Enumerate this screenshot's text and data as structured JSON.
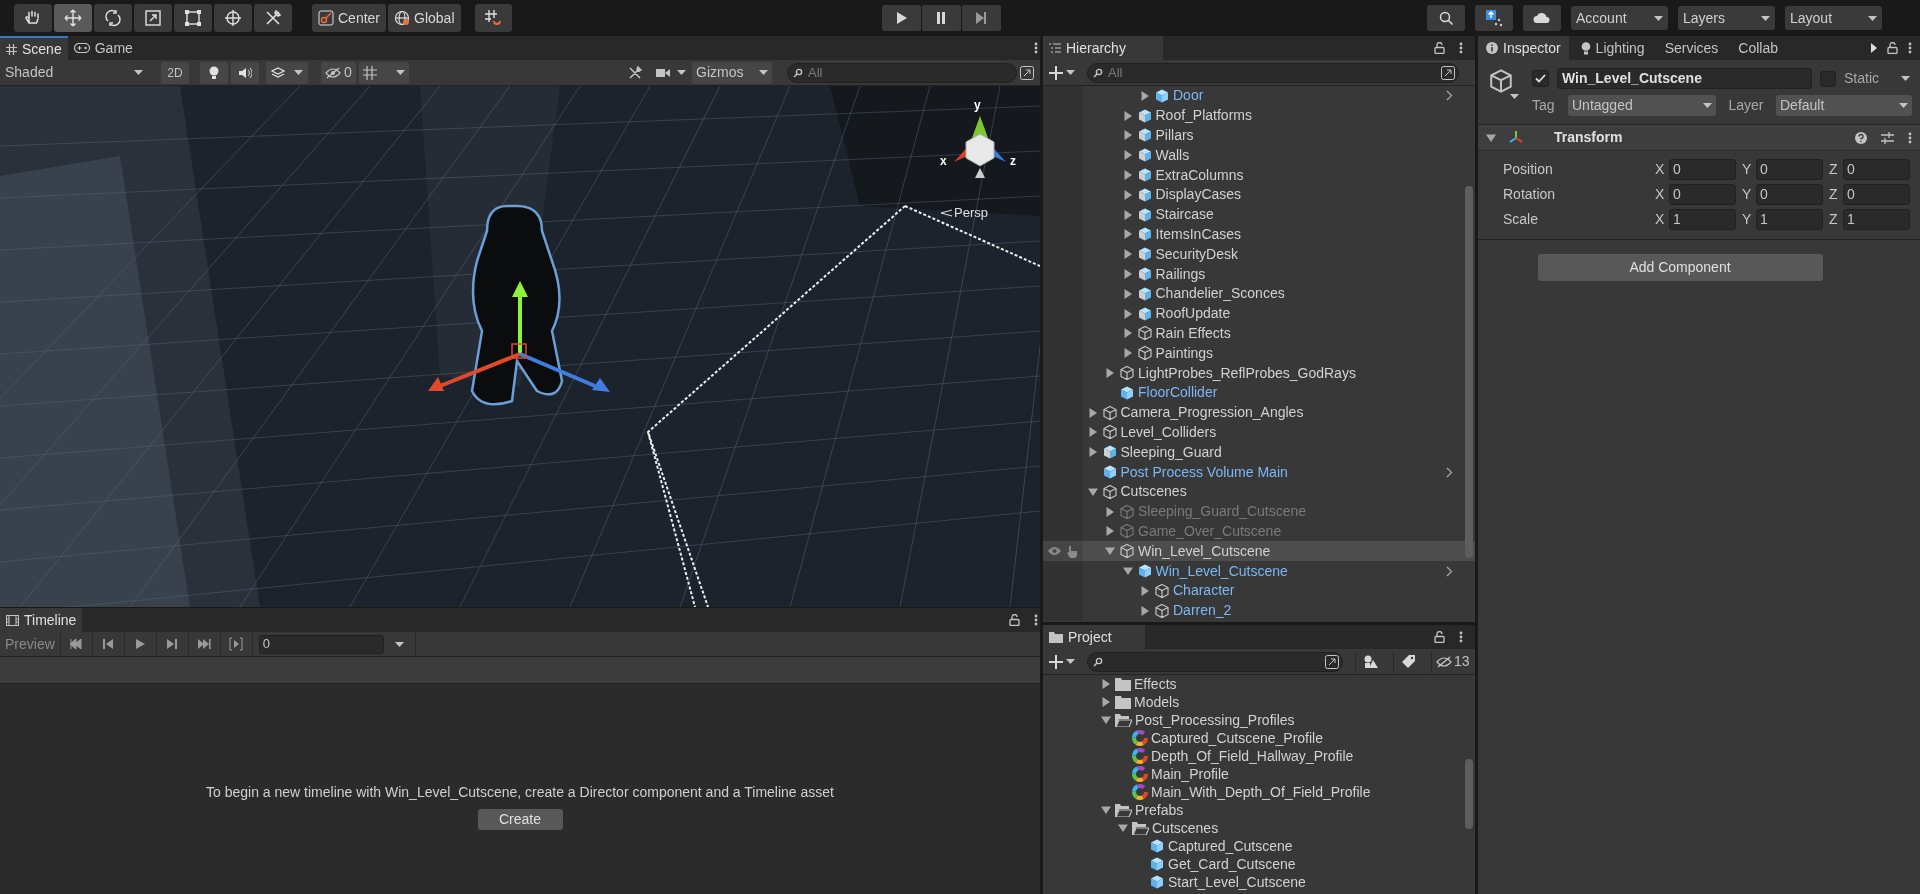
{
  "toolbar": {
    "tools": [
      {
        "kind": "hand",
        "selected": false
      },
      {
        "kind": "move",
        "selected": true
      },
      {
        "kind": "rotate",
        "selected": false
      },
      {
        "kind": "scale",
        "selected": false
      },
      {
        "kind": "rect",
        "selected": false
      },
      {
        "kind": "transform",
        "selected": false
      },
      {
        "kind": "custom",
        "selected": false
      }
    ],
    "pivot_mode": "Center",
    "pivot_rotation": "Global",
    "account": "Account",
    "layers": "Layers",
    "layout": "Layout"
  },
  "scene": {
    "tabs": [
      {
        "label": "Scene",
        "selected": true,
        "kind": "scene"
      },
      {
        "label": "Game",
        "selected": false,
        "kind": "game"
      }
    ],
    "shading": "Shaded",
    "mode_2d": "2D",
    "hidden_count": "0",
    "gizmos": "Gizmos",
    "search": {
      "placeholder": "All"
    },
    "orientation_gizmo": {
      "axes": [
        "y",
        "x",
        "z"
      ],
      "projection": "Persp"
    }
  },
  "timeline": {
    "title": "Timeline",
    "preview": "Preview",
    "frame": "0",
    "message": "To begin a new timeline with Win_Level_Cutscene, create a Director component and a Timeline asset",
    "create": "Create"
  },
  "hierarchy": {
    "title": "Hierarchy",
    "search": {
      "placeholder": "All"
    },
    "tree": [
      {
        "children": [
          {
            "children": [
              {
                "children": [
                  {
                    "label": "Door",
                    "kind": "prefab",
                    "expandable": true,
                    "expanded": false,
                    "prefab_member": true,
                    "active": true,
                    "selected": false,
                    "open_prefab": true
                  }
                ]
              },
              {
                "label": "Roof_Platforms",
                "kind": "prefab",
                "expandable": true,
                "expanded": false,
                "prefab_member": false,
                "active": true,
                "selected": false,
                "open_prefab": false
              },
              {
                "label": "Pillars",
                "kind": "prefab",
                "expandable": true,
                "expanded": false,
                "prefab_member": false,
                "active": true,
                "selected": false,
                "open_prefab": false
              },
              {
                "label": "Walls",
                "kind": "prefab",
                "expandable": true,
                "expanded": false,
                "prefab_member": false,
                "active": true,
                "selected": false,
                "open_prefab": false
              },
              {
                "label": "ExtraColumns",
                "kind": "prefab",
                "expandable": true,
                "expanded": false,
                "prefab_member": false,
                "active": true,
                "selected": false,
                "open_prefab": false
              },
              {
                "label": "DisplayCases",
                "kind": "prefab",
                "expandable": true,
                "expanded": false,
                "prefab_member": false,
                "active": true,
                "selected": false,
                "open_prefab": false
              },
              {
                "label": "Staircase",
                "kind": "prefab",
                "expandable": true,
                "expanded": false,
                "prefab_member": false,
                "active": true,
                "selected": false,
                "open_prefab": false
              },
              {
                "label": "ItemsInCases",
                "kind": "prefab",
                "expandable": true,
                "expanded": false,
                "prefab_member": false,
                "active": true,
                "selected": false,
                "open_prefab": false
              },
              {
                "label": "SecurityDesk",
                "kind": "prefab",
                "expandable": true,
                "expanded": false,
                "prefab_member": false,
                "active": true,
                "selected": false,
                "open_prefab": false
              },
              {
                "label": "Railings",
                "kind": "prefab",
                "expandable": true,
                "expanded": false,
                "prefab_member": false,
                "active": true,
                "selected": false,
                "open_prefab": false
              },
              {
                "label": "Chandelier_Sconces",
                "kind": "prefab",
                "expandable": true,
                "expanded": false,
                "prefab_member": false,
                "active": true,
                "selected": false,
                "open_prefab": false
              },
              {
                "label": "RoofUpdate",
                "kind": "prefab",
                "expandable": true,
                "expanded": false,
                "prefab_member": false,
                "active": true,
                "selected": false,
                "open_prefab": false
              },
              {
                "label": "Rain Effects",
                "kind": "object",
                "expandable": true,
                "expanded": false,
                "prefab_member": false,
                "active": true,
                "selected": false,
                "open_prefab": false
              },
              {
                "label": "Paintings",
                "kind": "object",
                "expandable": true,
                "expanded": false,
                "prefab_member": false,
                "active": true,
                "selected": false,
                "open_prefab": false
              }
            ]
          },
          {
            "label": "LightProbes_ReflProbes_GodRays",
            "kind": "object",
            "expandable": true,
            "expanded": false,
            "prefab_member": false,
            "active": true,
            "selected": false,
            "open_prefab": false
          },
          {
            "label": "FloorCollider",
            "kind": "prefab",
            "expandable": false,
            "prefab_member": true,
            "active": true,
            "selected": false,
            "open_prefab": false
          }
        ]
      },
      {
        "label": "Camera_Progression_Angles",
        "kind": "object",
        "expandable": true,
        "expanded": false,
        "prefab_member": false,
        "active": true,
        "selected": false,
        "open_prefab": false
      },
      {
        "label": "Level_Colliders",
        "kind": "object",
        "expandable": true,
        "expanded": false,
        "prefab_member": false,
        "active": true,
        "selected": false,
        "open_prefab": false
      },
      {
        "label": "Sleeping_Guard",
        "kind": "prefab",
        "expandable": true,
        "expanded": false,
        "prefab_member": false,
        "active": true,
        "selected": false,
        "open_prefab": false
      },
      {
        "label": "Post Process Volume Main",
        "kind": "prefab",
        "expandable": false,
        "prefab_member": true,
        "active": true,
        "selected": false,
        "open_prefab": true
      },
      {
        "label": "Cutscenes",
        "kind": "object",
        "expandable": true,
        "expanded": true,
        "prefab_member": false,
        "active": true,
        "selected": false,
        "open_prefab": false,
        "children": [
          {
            "label": "Sleeping_Guard_Cutscene",
            "kind": "object",
            "expandable": true,
            "expanded": false,
            "prefab_member": false,
            "active": false,
            "selected": false,
            "open_prefab": false
          },
          {
            "label": "Game_Over_Cutscene",
            "kind": "object",
            "expandable": true,
            "expanded": false,
            "prefab_member": false,
            "active": false,
            "selected": false,
            "open_prefab": false
          },
          {
            "label": "Win_Level_Cutscene",
            "kind": "object",
            "expandable": true,
            "expanded": true,
            "prefab_member": false,
            "active": true,
            "selected": true,
            "open_prefab": false,
            "children": [
              {
                "label": "Win_Level_Cutscene",
                "kind": "prefab",
                "expandable": true,
                "expanded": true,
                "prefab_member": true,
                "active": true,
                "selected": false,
                "open_prefab": true,
                "children": [
                  {
                    "label": "Character",
                    "kind": "object",
                    "expandable": true,
                    "expanded": false,
                    "prefab_member": true,
                    "active": true,
                    "selected": false,
                    "open_prefab": false
                  },
                  {
                    "label": "Darren_2",
                    "kind": "object",
                    "expandable": true,
                    "expanded": false,
                    "prefab_member": true,
                    "active": true,
                    "selected": false,
                    "open_prefab": false
                  }
                ]
              }
            ]
          }
        ]
      }
    ]
  },
  "project": {
    "title": "Project",
    "hidden_count": "13",
    "tree": [
      {
        "label": "Effects",
        "kind": "folder",
        "expandable": true,
        "expanded": false
      },
      {
        "label": "Models",
        "kind": "folder",
        "expandable": true,
        "expanded": false
      },
      {
        "label": "Post_Processing_Profiles",
        "kind": "folder",
        "expandable": true,
        "expanded": true,
        "children": [
          {
            "label": "Captured_Cutscene_Profile",
            "kind": "profile",
            "expandable": false
          },
          {
            "label": "Depth_Of_Field_Hallway_Profile",
            "kind": "profile",
            "expandable": false
          },
          {
            "label": "Main_Profile",
            "kind": "profile",
            "expandable": false
          },
          {
            "label": "Main_With_Depth_Of_Field_Profile",
            "kind": "profile",
            "expandable": false
          }
        ]
      },
      {
        "label": "Prefabs",
        "kind": "folder",
        "expandable": true,
        "expanded": true,
        "children": [
          {
            "label": "Cutscenes",
            "kind": "folder",
            "expandable": true,
            "expanded": true,
            "children": [
              {
                "label": "Captured_Cutscene",
                "kind": "prefab",
                "expandable": false
              },
              {
                "label": "Get_Card_Cutscene",
                "kind": "prefab",
                "expandable": false
              },
              {
                "label": "Start_Level_Cutscene",
                "kind": "prefab",
                "expandable": false
              }
            ]
          }
        ]
      }
    ]
  },
  "inspector": {
    "tabs": [
      {
        "label": "Inspector",
        "selected": true,
        "kind": "info"
      },
      {
        "label": "Lighting",
        "selected": false,
        "kind": "bulb"
      },
      {
        "label": "Services",
        "selected": false,
        "kind": "plain"
      },
      {
        "label": "Collab",
        "selected": false,
        "kind": "plain"
      }
    ],
    "object": {
      "active": true,
      "name": "Win_Level_Cutscene",
      "static": false,
      "static_label": "Static",
      "tag_label": "Tag",
      "tag": "Untagged",
      "layer_label": "Layer",
      "layer": "Default"
    },
    "component": {
      "title": "Transform",
      "expanded": true,
      "rows": [
        {
          "label": "Position",
          "values": [
            {
              "axis": "X",
              "value": "0"
            },
            {
              "axis": "Y",
              "value": "0"
            },
            {
              "axis": "Z",
              "value": "0"
            }
          ]
        },
        {
          "label": "Rotation",
          "values": [
            {
              "axis": "X",
              "value": "0"
            },
            {
              "axis": "Y",
              "value": "0"
            },
            {
              "axis": "Z",
              "value": "0"
            }
          ]
        },
        {
          "label": "Scale",
          "values": [
            {
              "axis": "X",
              "value": "1"
            },
            {
              "axis": "Y",
              "value": "1"
            },
            {
              "axis": "Z",
              "value": "1"
            }
          ]
        }
      ]
    },
    "add_component": "Add Component"
  }
}
